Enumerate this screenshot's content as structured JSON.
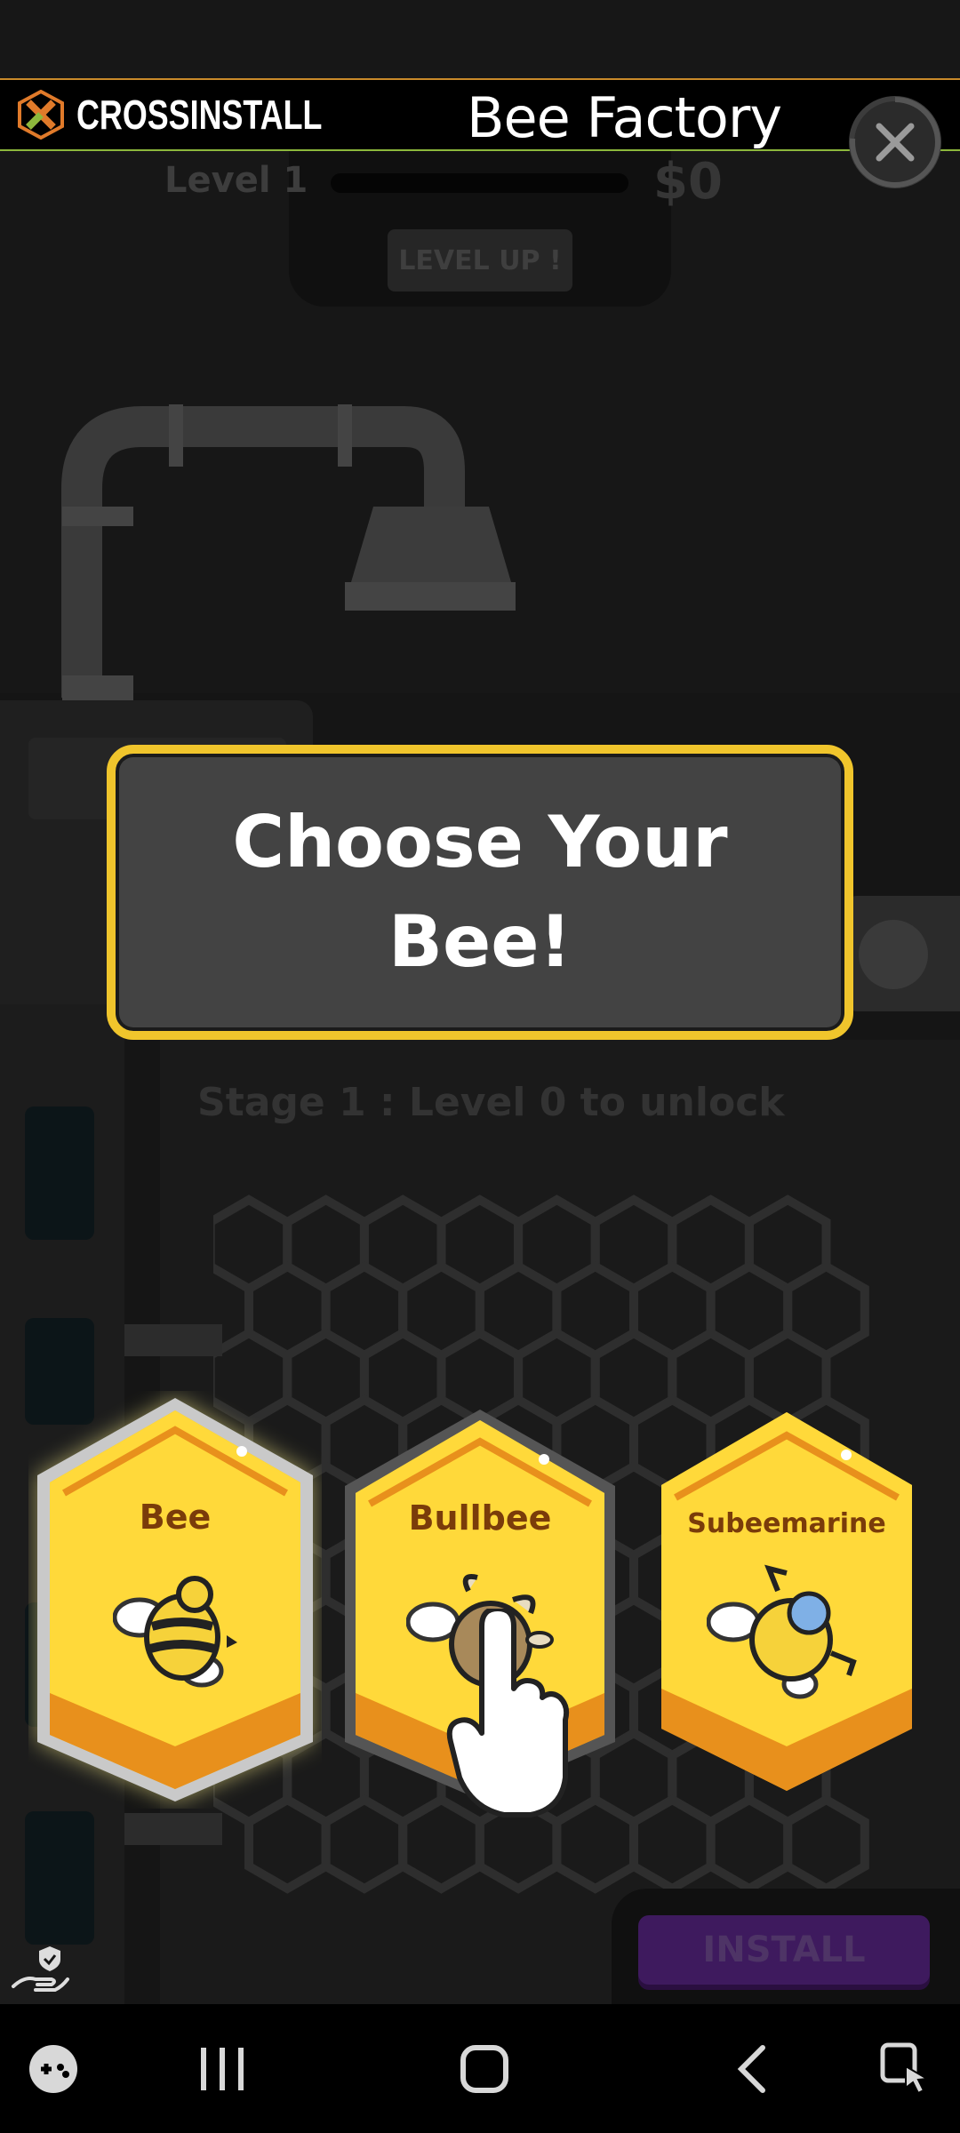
{
  "ad_header": {
    "brand": "CROSSINSTALL",
    "title": "Bee Factory",
    "close_icon": "close-icon"
  },
  "game_hud": {
    "level_label": "Level 1",
    "level_progress": 0,
    "money": "$0",
    "level_up_label": "LEVEL UP !"
  },
  "stage": {
    "text": "Stage 1 : Level 0 to unlock"
  },
  "popup": {
    "title": "Choose Your Bee!"
  },
  "bee_choices": [
    {
      "name": "Bee",
      "icon": "bee-icon",
      "selected": true
    },
    {
      "name": "Bullbee",
      "icon": "bullbee-icon",
      "selected": false
    },
    {
      "name": "Subeemarine",
      "icon": "subeemarine-icon",
      "selected": false
    }
  ],
  "install": {
    "label": "INSTALL"
  },
  "colors": {
    "gold": "#f0c52c",
    "card_yellow": "#ffd93a",
    "card_orange": "#e8901c",
    "install_purple": "#3e1a5e"
  },
  "nav_bar": {
    "icons": [
      "game-launcher-icon",
      "recent-apps-icon",
      "home-icon",
      "back-icon",
      "accessibility-icon"
    ]
  }
}
